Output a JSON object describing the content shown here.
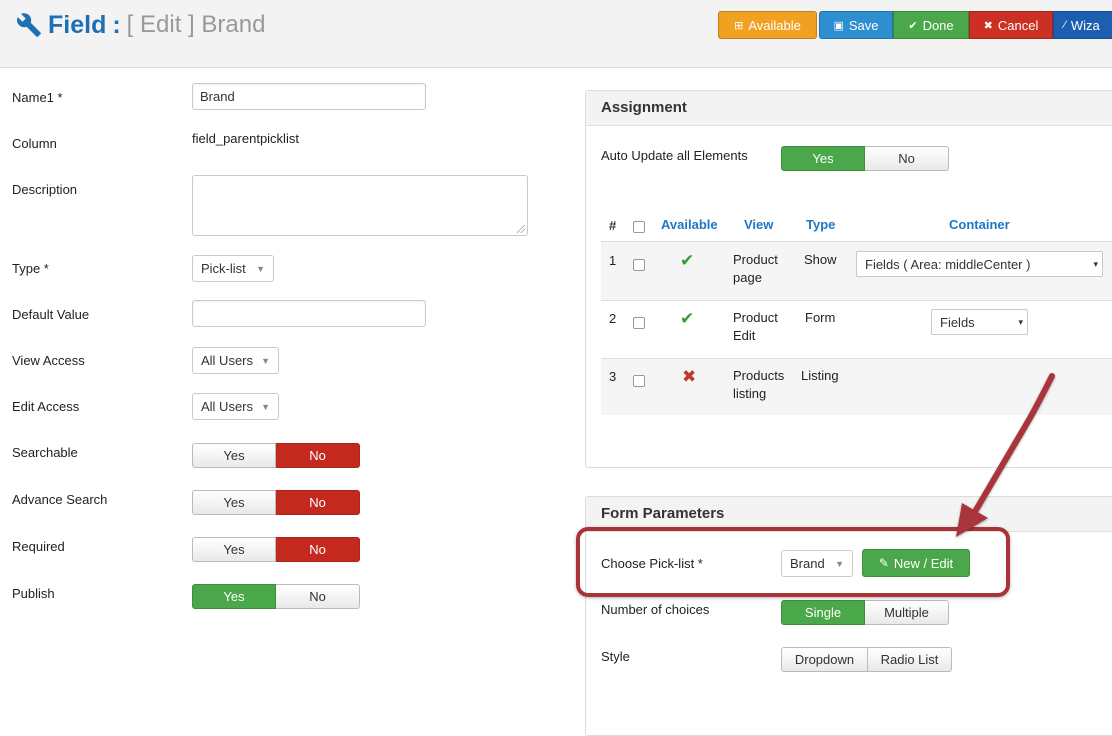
{
  "header": {
    "title_main": "Field",
    "title_sep": ":",
    "title_sub": "[ Edit ] Brand",
    "buttons": {
      "available": "Available",
      "save": "Save",
      "done": "Done",
      "cancel": "Cancel",
      "wizard": "Wiza"
    }
  },
  "form": {
    "name_label": "Name1 *",
    "name_value": "Brand",
    "column_label": "Column",
    "column_value": "field_parentpicklist",
    "description_label": "Description",
    "type_label": "Type *",
    "type_value": "Pick-list",
    "default_label": "Default Value",
    "view_access_label": "View Access",
    "view_access_value": "All Users",
    "edit_access_label": "Edit Access",
    "edit_access_value": "All Users",
    "searchable_label": "Searchable",
    "advance_search_label": "Advance Search",
    "required_label": "Required",
    "publish_label": "Publish",
    "yes": "Yes",
    "no": "No"
  },
  "assignment": {
    "title": "Assignment",
    "auto_update_label": "Auto Update all Elements",
    "yes": "Yes",
    "no": "No",
    "columns": {
      "hash": "#",
      "available": "Available",
      "view": "View",
      "type": "Type",
      "container": "Container"
    },
    "rows": [
      {
        "num": "1",
        "available": true,
        "view_line1": "Product",
        "view_line2": "page",
        "type": "Show",
        "container": "Fields ( Area: middleCenter )"
      },
      {
        "num": "2",
        "available": true,
        "view_line1": "Product",
        "view_line2": "Edit",
        "type": "Form",
        "container": "Fields"
      },
      {
        "num": "3",
        "available": false,
        "view_line1": "Products",
        "view_line2": "listing",
        "type": "Listing",
        "container": ""
      }
    ]
  },
  "form_parameters": {
    "title": "Form Parameters",
    "picklist_label": "Choose Pick-list *",
    "picklist_value": "Brand",
    "new_edit_label": "New / Edit",
    "choices_label": "Number of choices",
    "single": "Single",
    "multiple": "Multiple",
    "style_label": "Style",
    "dropdown": "Dropdown",
    "radio_list": "Radio List"
  },
  "colors": {
    "brand_blue": "#1f6fb5",
    "available_orange": "#f0a122",
    "save_blue": "#2d8fd0",
    "done_green": "#4aa84a",
    "cancel_red": "#cc2f24",
    "toggle_red": "#c4291f",
    "annotation_red": "#a8343a"
  }
}
